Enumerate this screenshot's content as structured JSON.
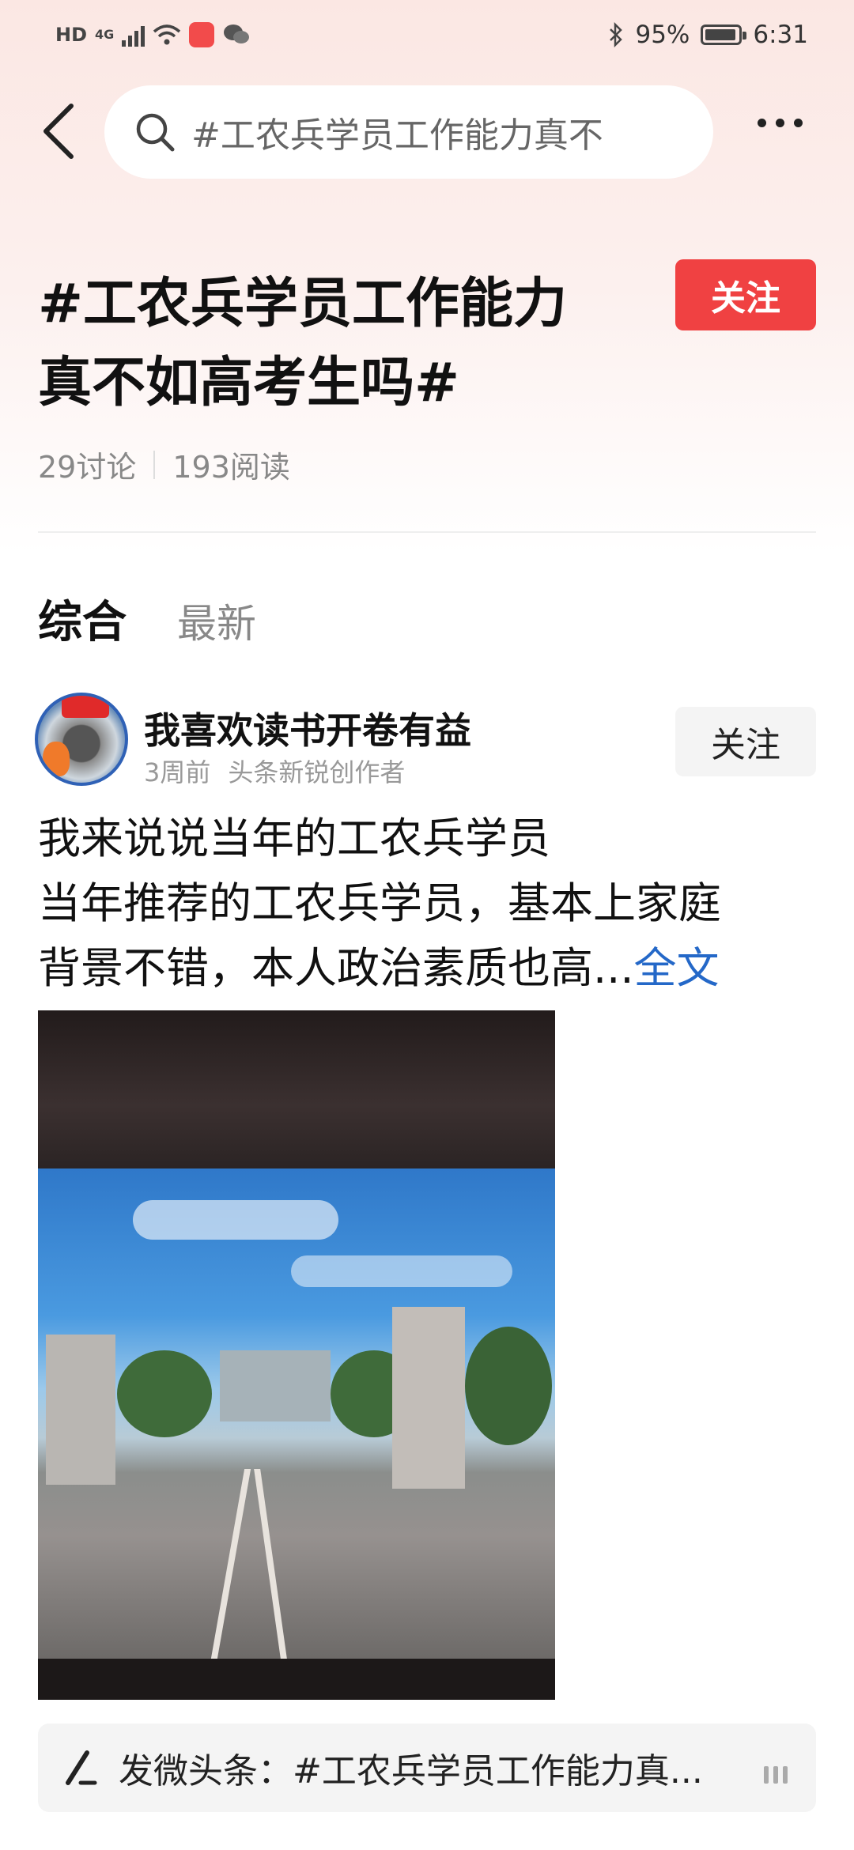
{
  "status_bar": {
    "network_hd": "HD",
    "network_type": "4G",
    "battery_percent": "95%",
    "battery_level": 0.95,
    "time": "6:31"
  },
  "header": {
    "search_text": "#工农兵学员工作能力真不",
    "icons": [
      "back-arrow-icon",
      "search-icon",
      "more-icon"
    ]
  },
  "topic": {
    "title_line1": "#工农兵学员工作能力",
    "title_line2": "真不如高考生吗#",
    "follow_label": "关注",
    "discussions": "29讨论",
    "reads": "193阅读"
  },
  "tabs": [
    {
      "label": "综合",
      "active": true
    },
    {
      "label": "最新",
      "active": false
    }
  ],
  "post": {
    "author": "我喜欢读书开卷有益",
    "time_ago": "3周前",
    "author_tag": "头条新锐创作者",
    "follow_label": "关注",
    "line1": "我来说说当年的工农兵学员",
    "line2": "当年推荐的工农兵学员，基本上家庭",
    "line3": "背景不错，本人政治素质也高...",
    "more_link": "全文"
  },
  "composer": {
    "text": "发微头条：#工农兵学员工作能力真..."
  },
  "colors": {
    "accent_red": "#f04142",
    "link_blue": "#2468c8"
  }
}
